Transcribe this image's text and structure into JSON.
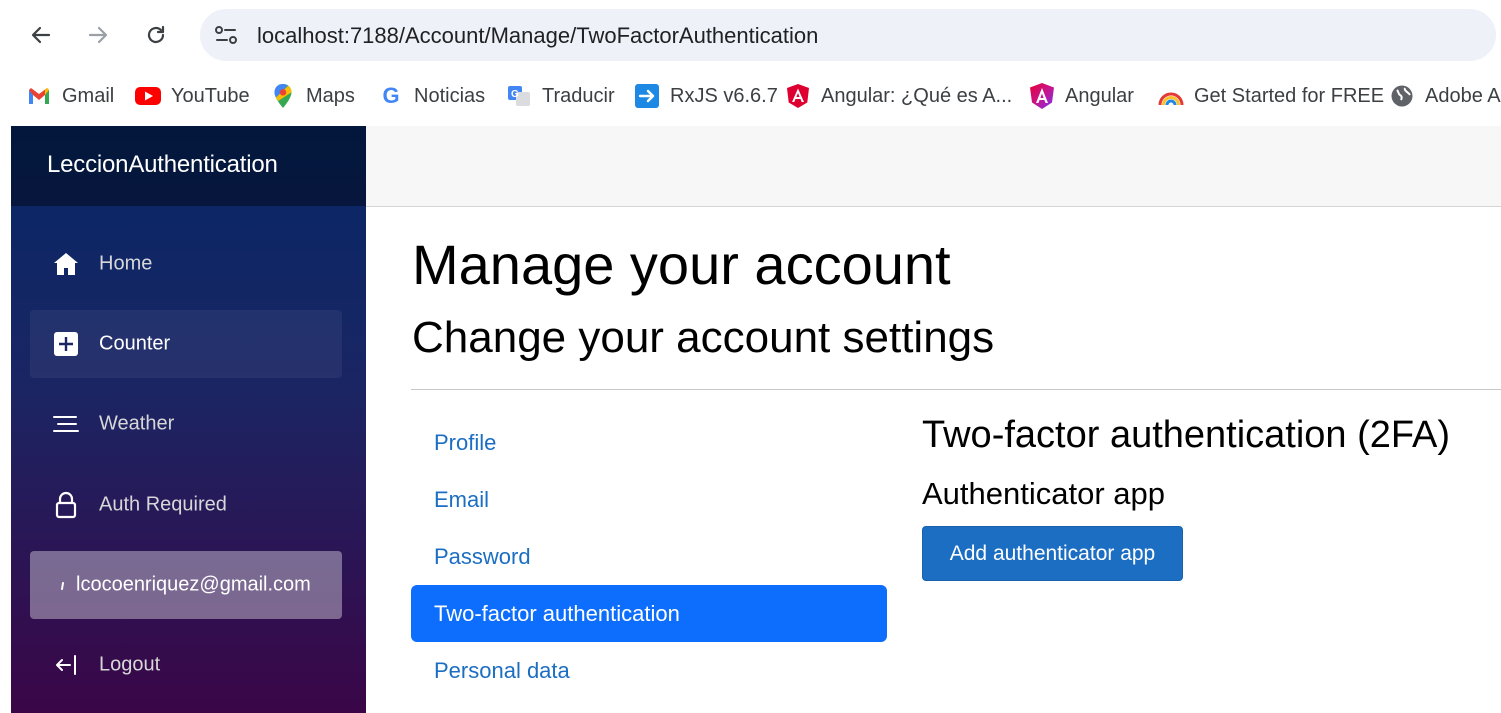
{
  "browser": {
    "url": "localhost:7188/Account/Manage/TwoFactorAuthentication",
    "bookmarks": [
      {
        "label": "Gmail",
        "icon": "gmail-icon"
      },
      {
        "label": "YouTube",
        "icon": "youtube-icon"
      },
      {
        "label": "Maps",
        "icon": "maps-pin-icon"
      },
      {
        "label": "Noticias",
        "icon": "google-g-icon"
      },
      {
        "label": "Traducir",
        "icon": "translate-icon"
      },
      {
        "label": "RxJS v6.6.7",
        "icon": "arrow-right-icon"
      },
      {
        "label": "Angular: ¿Qué es A...",
        "icon": "angular-shield-icon"
      },
      {
        "label": "Angular",
        "icon": "angular-gradient-icon"
      },
      {
        "label": "Get Started for FREE",
        "icon": "rainbow-icon"
      },
      {
        "label": "Adobe A",
        "icon": "globe-icon"
      }
    ]
  },
  "app": {
    "brand": "LeccionAuthentication",
    "nav": [
      {
        "label": "Home",
        "icon": "home-icon"
      },
      {
        "label": "Counter",
        "icon": "plus-square-icon"
      },
      {
        "label": "Weather",
        "icon": "list-lines-icon"
      },
      {
        "label": "Auth Required",
        "icon": "lock-icon"
      },
      {
        "label": "lcocoenriquez@gmail.com",
        "icon": "person-icon"
      },
      {
        "label": "Logout",
        "icon": "logout-arrow-icon"
      }
    ]
  },
  "page": {
    "title": "Manage your account",
    "subtitle": "Change your account settings",
    "manage_nav": [
      "Profile",
      "Email",
      "Password",
      "Two-factor authentication",
      "Personal data"
    ],
    "section_title": "Two-factor authentication (2FA)",
    "section_subtitle": "Authenticator app",
    "add_button": "Add authenticator app"
  },
  "colors": {
    "link": "#1b6ec2",
    "active_nav": "#0d6efd",
    "button": "#1b6ec2",
    "sidebar_top": "#052767",
    "sidebar_bottom": "#3a0647"
  }
}
